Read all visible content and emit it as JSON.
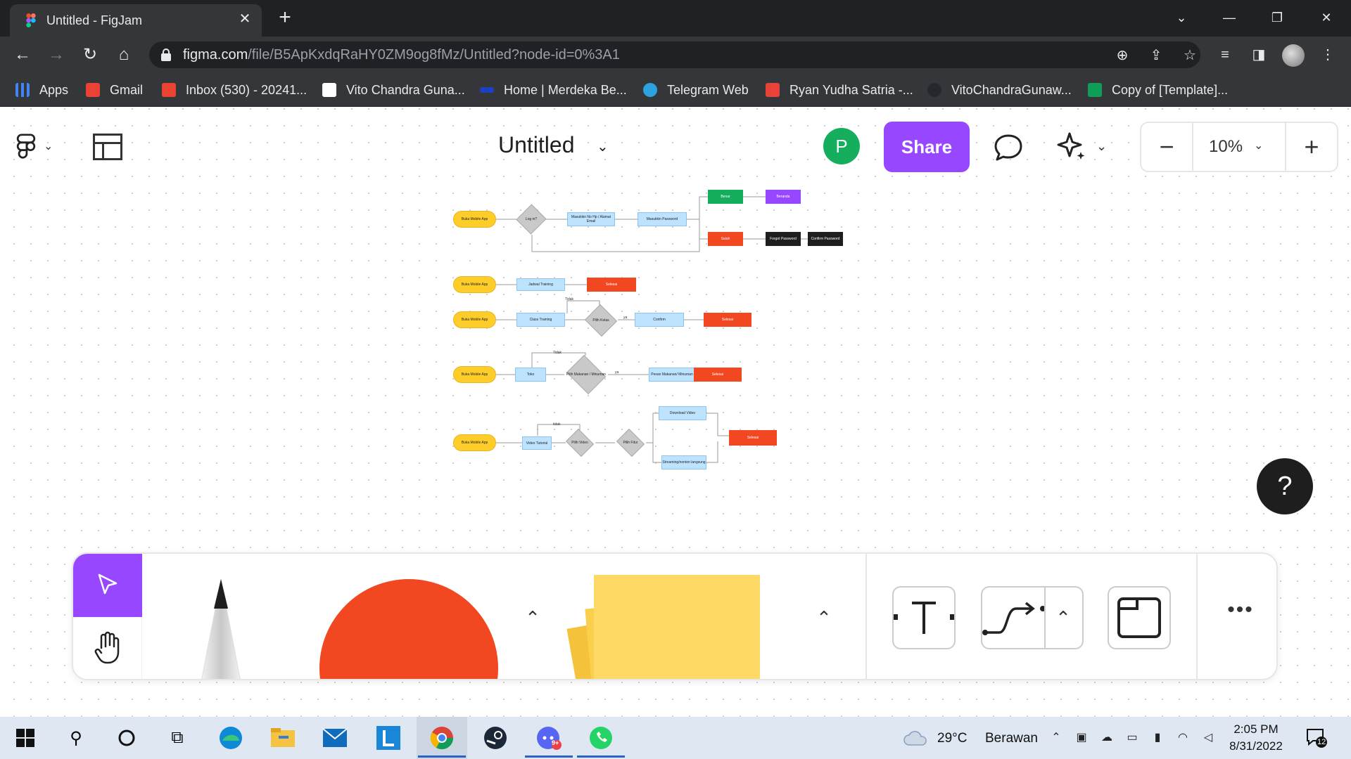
{
  "browser": {
    "tab_title": "Untitled - FigJam",
    "url_host": "figma.com",
    "url_path": "/file/B5ApKxdqRaHY0ZM9og8fMz/Untitled?node-id=0%3A1",
    "bookmarks": [
      {
        "label": "Apps",
        "icon": "apps-grid-icon",
        "color": "#4285f4"
      },
      {
        "label": "Gmail",
        "icon": "gmail-icon",
        "color": "#ea4335"
      },
      {
        "label": "Inbox (530) - 20241...",
        "icon": "gmail-icon",
        "color": "#ea4335"
      },
      {
        "label": "Vito Chandra Guna...",
        "icon": "page-icon",
        "color": "#ffffff"
      },
      {
        "label": "Home | Merdeka Be...",
        "icon": "merdeka-icon",
        "color": "#1f3fbf"
      },
      {
        "label": "Telegram Web",
        "icon": "telegram-icon",
        "color": "#2aa3df"
      },
      {
        "label": "Ryan Yudha Satria -...",
        "icon": "r-icon",
        "color": "#e8423a"
      },
      {
        "label": "VitoChandraGunaw...",
        "icon": "github-icon",
        "color": "#24292e"
      },
      {
        "label": "Copy of [Template]...",
        "icon": "sheets-icon",
        "color": "#0f9d58"
      }
    ]
  },
  "figjam": {
    "file_title": "Untitled",
    "avatar_initial": "P",
    "share_label": "Share",
    "zoom_label": "10%",
    "help_label": "?",
    "accent": "#9747ff"
  },
  "flow": {
    "login": {
      "start": "Buka Mobile App",
      "decision": "Log in?",
      "input_phone": "Masukkin No Hp / Alamat Email",
      "input_password": "Masukkin Password",
      "success": "Benar",
      "next": "Beranda",
      "failed": "Salah",
      "forgot": "Forgot Password",
      "confirm": "Confirm Password"
    },
    "schedule": {
      "start": "Buka Mobile App",
      "step": "Jadwal Training",
      "end": "Selesai"
    },
    "class": {
      "start": "Buka Mobile App",
      "step": "Class Training",
      "decision": "Pilih Kelas",
      "no": "Tidak",
      "yes": "ya",
      "confirm": "Confirm",
      "end": "Selesai"
    },
    "shop": {
      "start": "Buka Mobile App",
      "step": "Toko",
      "decision": "Pilih Makanan / Minuman",
      "no": "Tidak",
      "yes": "ya",
      "order": "Pesan Makanan/ Minuman",
      "end": "Selesai"
    },
    "video": {
      "start": "Buka Mobile App",
      "step": "Video Tutorial",
      "decision": "Pilih Video",
      "no": "tidak",
      "feature": "Pilih Fitur",
      "download": "Download Video",
      "stream": "Streaming/nonton langsung",
      "end": "Selesai"
    }
  },
  "taskbar": {
    "weather_temp": "29°C",
    "weather_text": "Berawan",
    "time": "2:05 PM",
    "date": "8/31/2022",
    "notifications": "12",
    "discord_badge": "9+"
  }
}
